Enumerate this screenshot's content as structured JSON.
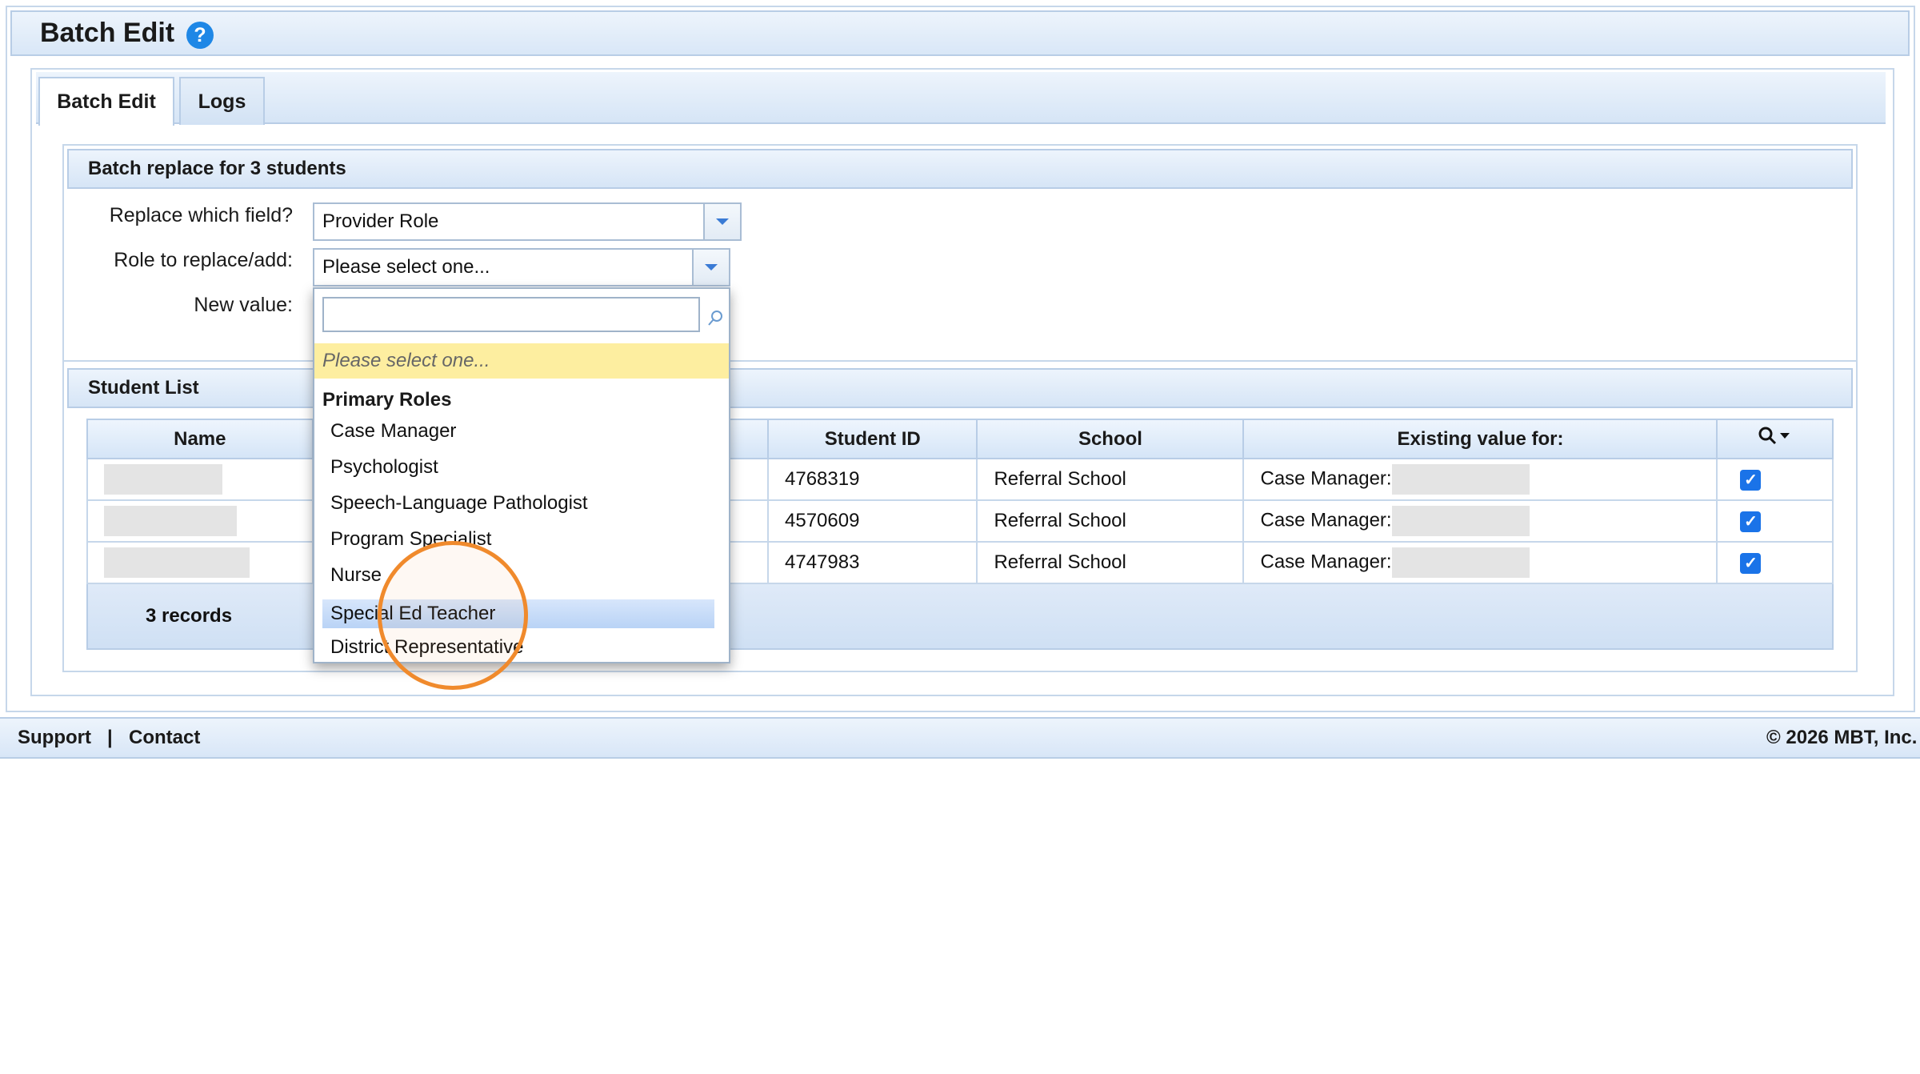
{
  "header": {
    "title": "Batch Edit",
    "help_glyph": "?"
  },
  "tabs": [
    {
      "label": "Batch Edit",
      "active": true
    },
    {
      "label": "Logs",
      "active": false
    }
  ],
  "batch": {
    "heading": "Batch replace for 3 students",
    "field_label": "Replace which field?",
    "field_value": "Provider Role",
    "role_label": "Role to replace/add:",
    "role_value": "Please select one...",
    "new_value_label": "New value:"
  },
  "dropdown": {
    "search_value": "",
    "placeholder_option": "Please select one...",
    "group": "Primary Roles",
    "items": [
      "Case Manager",
      "Psychologist",
      "Speech-Language Pathologist",
      "Program Specialist",
      "Nurse",
      "Special Ed Teacher",
      "District Representative"
    ],
    "highlighted": "Special Ed Teacher"
  },
  "student_list": {
    "heading": "Student List",
    "columns": [
      "Name",
      "Student ID",
      "School",
      "Existing value for:"
    ],
    "rows": [
      {
        "student_id": "4768319",
        "school": "Referral School",
        "existing": "Case Manager:",
        "checked": true
      },
      {
        "student_id": "4570609",
        "school": "Referral School",
        "existing": "Case Manager:",
        "checked": true
      },
      {
        "student_id": "4747983",
        "school": "Referral School",
        "existing": "Case Manager:",
        "checked": true
      }
    ],
    "record_count": "3 records"
  },
  "footer": {
    "support": "Support",
    "separator": "|",
    "contact": "Contact",
    "copyright": "© 2026 MBT, Inc."
  },
  "colors": {
    "accent": "#1e87e6",
    "highlight_ring": "#f08a2c",
    "header_bg": "#d9e7f7",
    "placeholder_bg": "#fdeea0"
  }
}
